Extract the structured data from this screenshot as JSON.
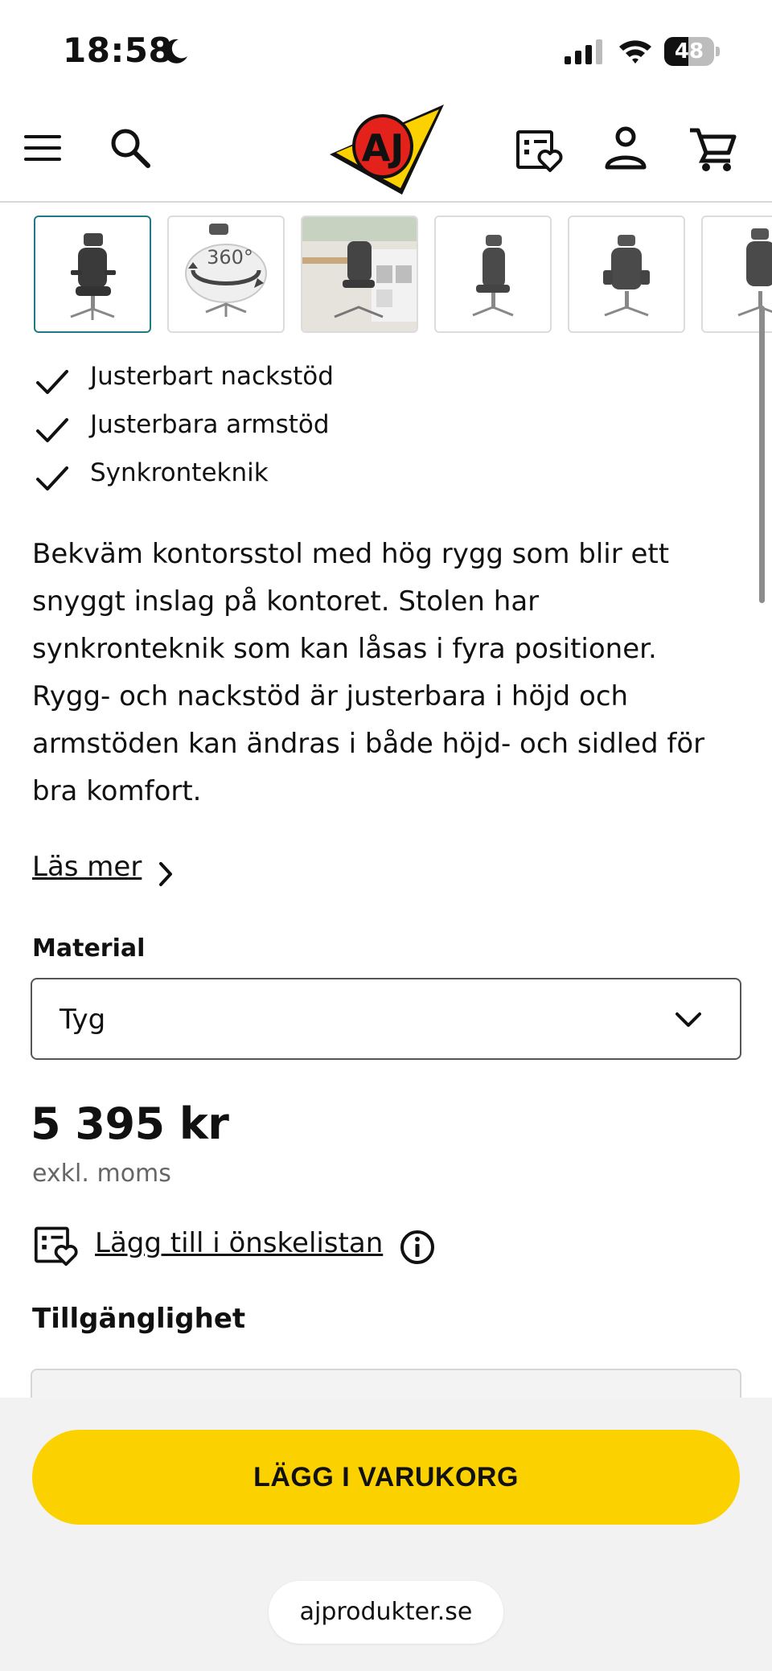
{
  "status_bar": {
    "time": "18:58",
    "battery_level": "48",
    "icons": [
      "moon-icon",
      "cellular-signal-icon",
      "wifi-icon",
      "battery-icon"
    ]
  },
  "header": {
    "logo_text": "AJ",
    "icons": [
      "menu-icon",
      "search-icon",
      "wishlist-icon",
      "account-icon",
      "cart-icon"
    ]
  },
  "gallery": {
    "thumbnails": [
      {
        "name": "chair-front-headrest",
        "selected": true
      },
      {
        "name": "360-view"
      },
      {
        "name": "office-environment"
      },
      {
        "name": "chair-side"
      },
      {
        "name": "chair-front"
      },
      {
        "name": "chair-angle"
      }
    ],
    "badge_360": "360°"
  },
  "features": [
    "Justerbart nackstöd",
    "Justerbara armstöd",
    "Synkronteknik"
  ],
  "description": "Bekväm kontorsstol med hög rygg som blir ett snyggt inslag på kontoret. Stolen har synkronteknik som kan låsas i fyra positioner. Rygg- och nackstöd är justerbara i höjd och armstöden kan ändras i både höjd- och sidled för bra komfort.",
  "read_more": "Läs mer",
  "material": {
    "label": "Material",
    "selected": "Tyg"
  },
  "price": {
    "amount": "5 395 kr",
    "vat_note": "exkl. moms"
  },
  "wishlist": {
    "label": "Lägg till i önskelistan"
  },
  "availability": {
    "label": "Tillgänglighet"
  },
  "cta": {
    "label": "LÄGG I VARUKORG",
    "color": "#fcd100"
  },
  "browser": {
    "url": "ajprodukter.se"
  },
  "colors": {
    "accent": "#fcd100",
    "logo_red": "#e3231b",
    "selected_border": "#1f7a86"
  }
}
